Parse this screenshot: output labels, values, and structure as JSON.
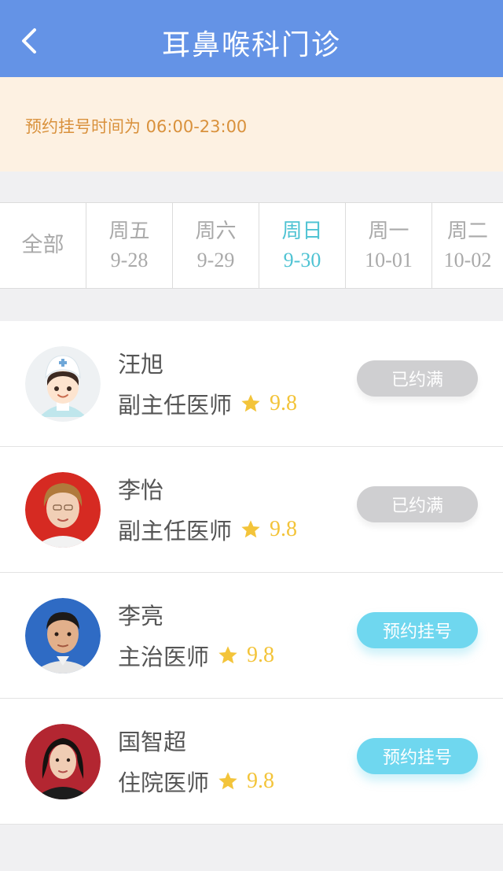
{
  "header": {
    "title": "耳鼻喉科门诊",
    "background_color": "#6493e6"
  },
  "notice": {
    "text": "预约挂号时间为 06:00-23:00",
    "text_color": "#d9913c"
  },
  "date_tabs": [
    {
      "label": "全部",
      "date": ""
    },
    {
      "label": "周五",
      "date": "9-28"
    },
    {
      "label": "周六",
      "date": "9-29"
    },
    {
      "label": "周日",
      "date": "9-30",
      "selected": true
    },
    {
      "label": "周一",
      "date": "10-01"
    },
    {
      "label": "周二",
      "date": "10-02"
    }
  ],
  "doctors": [
    {
      "name": "汪旭",
      "title": "副主任医师",
      "rating": "9.8",
      "action": "已约满",
      "status": "full",
      "avatar_icon": "nurse-cartoon-avatar"
    },
    {
      "name": "李怡",
      "title": "副主任医师",
      "rating": "9.8",
      "action": "已约满",
      "status": "full",
      "avatar_icon": "photo-red-background"
    },
    {
      "name": "李亮",
      "title": "主治医师",
      "rating": "9.8",
      "action": "预约挂号",
      "status": "available",
      "avatar_icon": "photo-blue-background"
    },
    {
      "name": "国智超",
      "title": "住院医师",
      "rating": "9.8",
      "action": "预约挂号",
      "status": "available",
      "avatar_icon": "photo-red-background"
    }
  ],
  "colors": {
    "accent_tab": "#4fc3d3",
    "star": "#f3c43a",
    "button_full": "#cfcfd1",
    "button_book": "#6fd7ef"
  }
}
